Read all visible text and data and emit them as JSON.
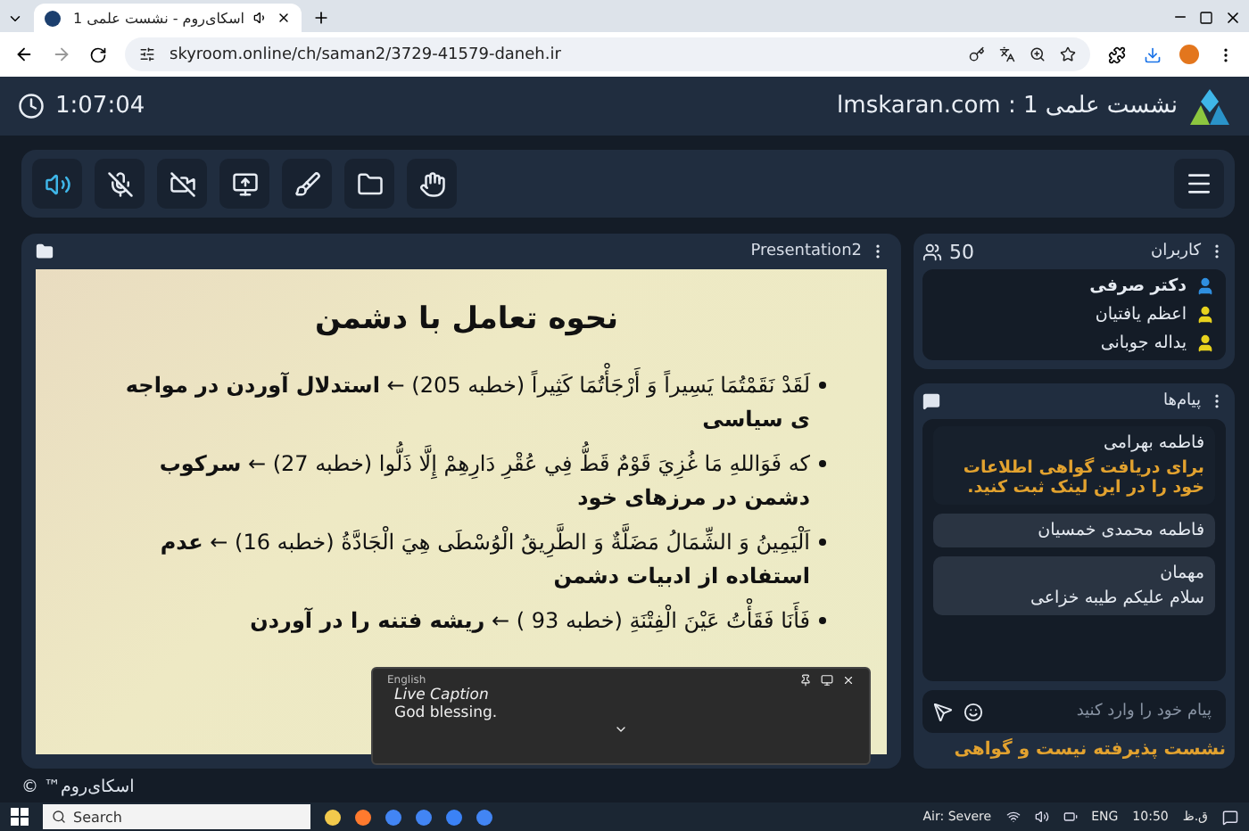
{
  "browser": {
    "tab_title": "اسکای‌روم - نشست علمی 1",
    "url": "skyroom.online/ch/saman2/3729-41579-daneh.ir"
  },
  "header": {
    "timer": "1:07:04",
    "title": "lmskaran.com : نشست علمی 1"
  },
  "toolbar": {
    "buttons": [
      {
        "kind": "speaker",
        "selected": true
      },
      {
        "kind": "mic-off",
        "selected": false
      },
      {
        "kind": "video-off",
        "selected": false
      },
      {
        "kind": "screen",
        "selected": false
      },
      {
        "kind": "brush",
        "selected": false
      },
      {
        "kind": "folder",
        "selected": false
      },
      {
        "kind": "hand",
        "selected": false
      }
    ]
  },
  "presentation": {
    "title": "Presentation2",
    "slide_title": "نحوه تعامل با دشمن",
    "bullets": [
      "لَقَدْ نَقَمْتُمَا يَسِيراً وَ أَرْجَأْتُمَا كَثِيراً (خطبه 205) ← **استدلال آوردن در مواجه ی سیاسی**",
      "که فَوَاللهِ مَا غُزِيَ قَوْمٌ قَطُّ فِي عُقْرِ دَارِهِمْ إِلَّا ذَلُّوا (خطبه 27) ← **سرکوب دشمن در مرزهای خود**",
      "اَلْيَمِينُ وَ الشِّمَالُ مَضَلَّةٌ وَ الطَّرِيقُ الْوُسْطَى هِيَ الْجَادَّةُ (خطبه 16) ← **عدم استفاده از ادبیات دشمن**",
      "فَأَنَا فَقَأْتُ عَيْنَ الْفِتْنَةِ (خطبه 93 ) ← **ریشه فتنه را در آوردن**"
    ]
  },
  "caption": {
    "language": "English",
    "title": "Live Caption",
    "text": "God blessing."
  },
  "users": {
    "title": "کاربران",
    "count": "50",
    "items": [
      {
        "name": "دکتر صرفی",
        "color": "#2f8fe0",
        "bold": true
      },
      {
        "name": "اعظم یافتیان",
        "color": "#e8d21e",
        "bold": false
      },
      {
        "name": "یداله جوبانی",
        "color": "#e8d21e",
        "bold": false
      }
    ]
  },
  "messages": {
    "title": "پیام‌ها",
    "items": [
      {
        "sender": "فاطمه بهرامی",
        "text": "برای دریافت گواهی اطلاعات خود را در این لینک ثبت کنید.",
        "highlight": true
      },
      {
        "sender": "فاطمه محمدی خمسیان",
        "highlight": false
      },
      {
        "sender": "مهمان",
        "text": "سلام علیکم طیبه خزاعی",
        "highlight": false
      }
    ],
    "placeholder": "پیام خود را وارد کنید",
    "notice": "نشست پذیرفته نیست و گواهی"
  },
  "footer": "اسکای‌روم™ ©",
  "taskbar": {
    "search": "Search",
    "weather": "Air: Severe",
    "language": "ENG",
    "time": "10:50",
    "period": "ق.ظ"
  }
}
